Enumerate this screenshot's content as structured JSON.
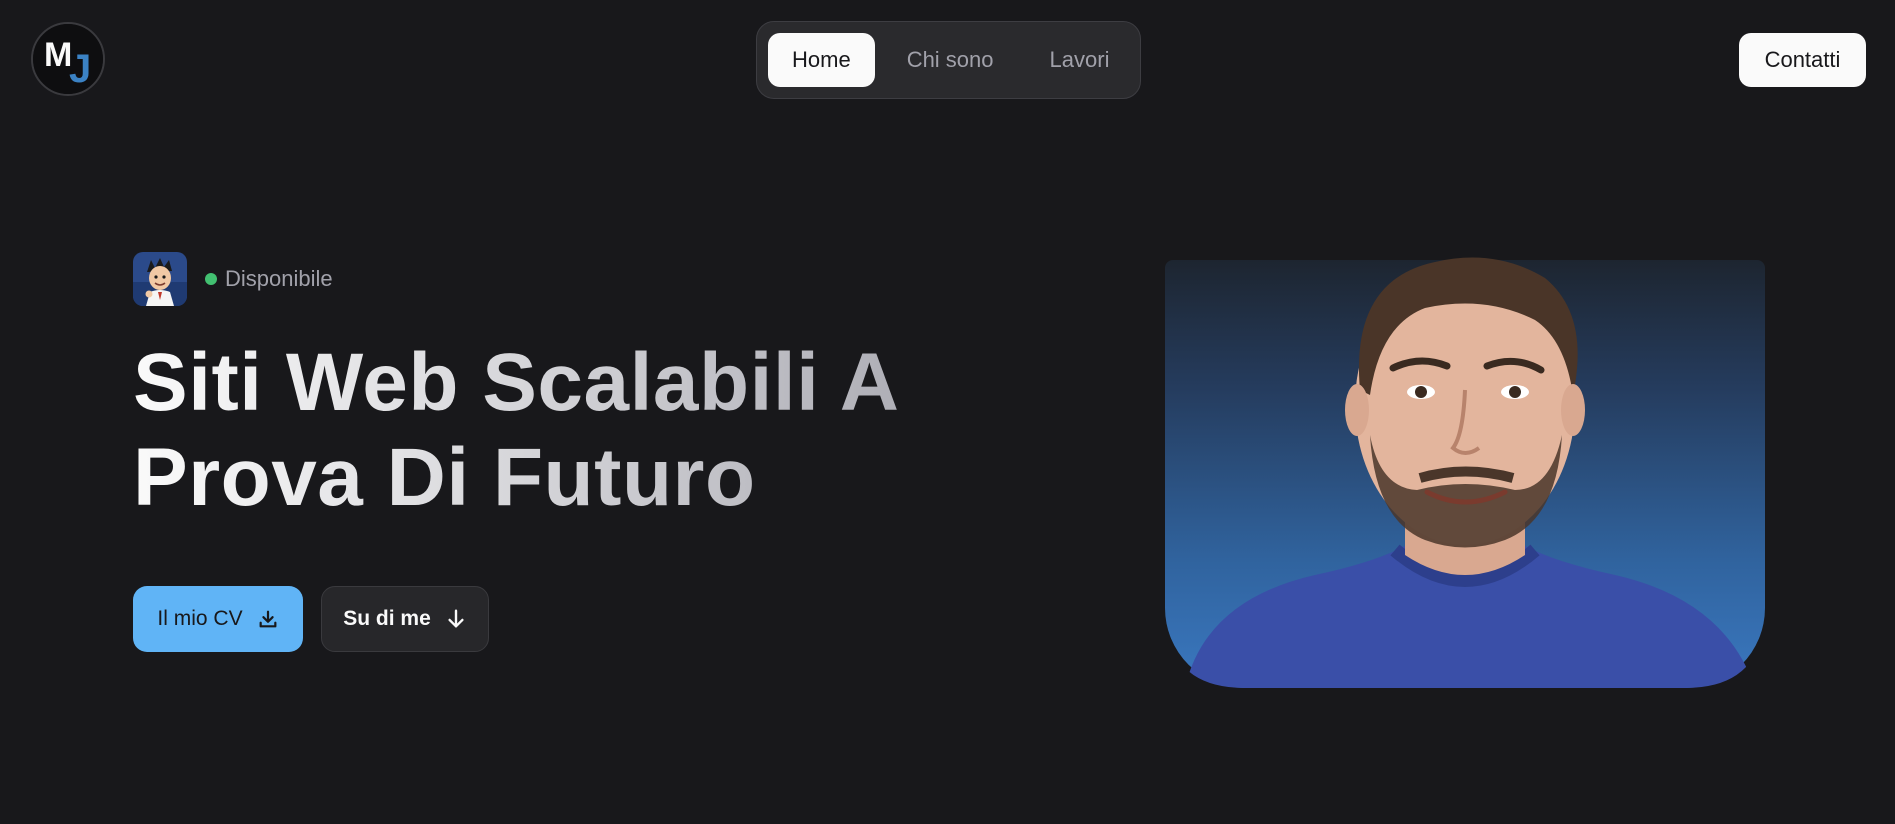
{
  "header": {
    "logo": {
      "text": "MJ",
      "icon": "mj-monogram-logo"
    },
    "nav": [
      {
        "label": "Home",
        "active": true
      },
      {
        "label": "Chi sono",
        "active": false
      },
      {
        "label": "Lavori",
        "active": false
      }
    ],
    "contact_label": "Contatti"
  },
  "hero": {
    "avatar_icon": "cartoon-avatar",
    "status_text": "Disponibile",
    "status_color": "#4ade80",
    "headline_line1": "Siti Web Scalabili A",
    "headline_line2": "Prova Di Futuro",
    "cv_button_label": "Il mio CV",
    "cv_button_icon": "download-icon",
    "about_button_label": "Su di me",
    "about_button_icon": "arrow-down-icon",
    "photo": "portrait-photo"
  },
  "colors": {
    "background": "#18181b",
    "accent": "#60b4f6",
    "nav_bg": "#2a2a2d",
    "active_nav": "#fafafa"
  }
}
